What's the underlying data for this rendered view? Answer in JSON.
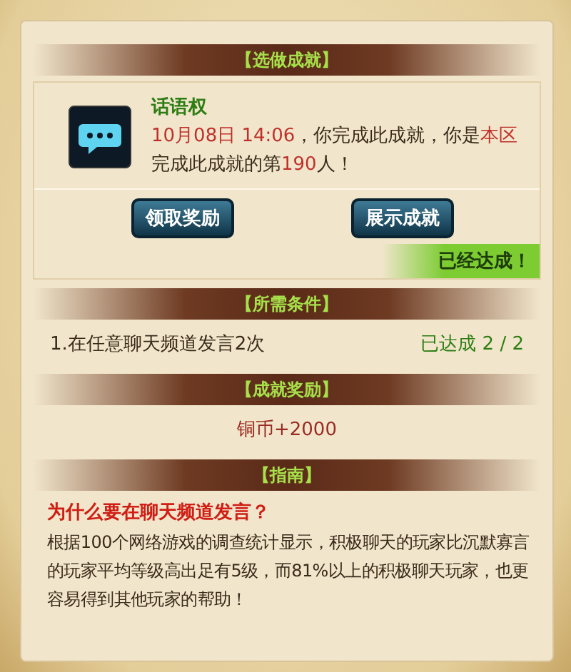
{
  "sections": [
    {
      "kind": "achievement",
      "title": "【选做成就】",
      "name": "话语权",
      "message": [
        {
          "text": "10月08日 14:06",
          "highlight": true
        },
        {
          "text": "，你完成此成就，你是",
          "highlight": false
        },
        {
          "text": "本区",
          "highlight": true
        },
        {
          "text": "完成此成就的第",
          "highlight": false
        },
        {
          "text": "190",
          "highlight": true
        },
        {
          "text": "人！",
          "highlight": false
        }
      ],
      "buttons": [
        "领取奖励",
        "展示成就"
      ],
      "status": "已经达成！"
    },
    {
      "kind": "conditions",
      "title": "【所需条件】",
      "items": [
        {
          "text": "1.在任意聊天频道发言2次",
          "progress": "已达成 2 / 2"
        }
      ]
    },
    {
      "kind": "reward",
      "title": "【成就奖励】",
      "text": "铜币+2000"
    },
    {
      "kind": "guide",
      "title": "【指南】",
      "question": "为什么要在聊天频道发言？",
      "text": "根据100个网络游戏的调查统计显示，积极聊天的玩家比沉默寡言的玩家平均等级高出足有5级，而81%以上的积极聊天玩家，也更容易得到其他玩家的帮助！"
    }
  ]
}
